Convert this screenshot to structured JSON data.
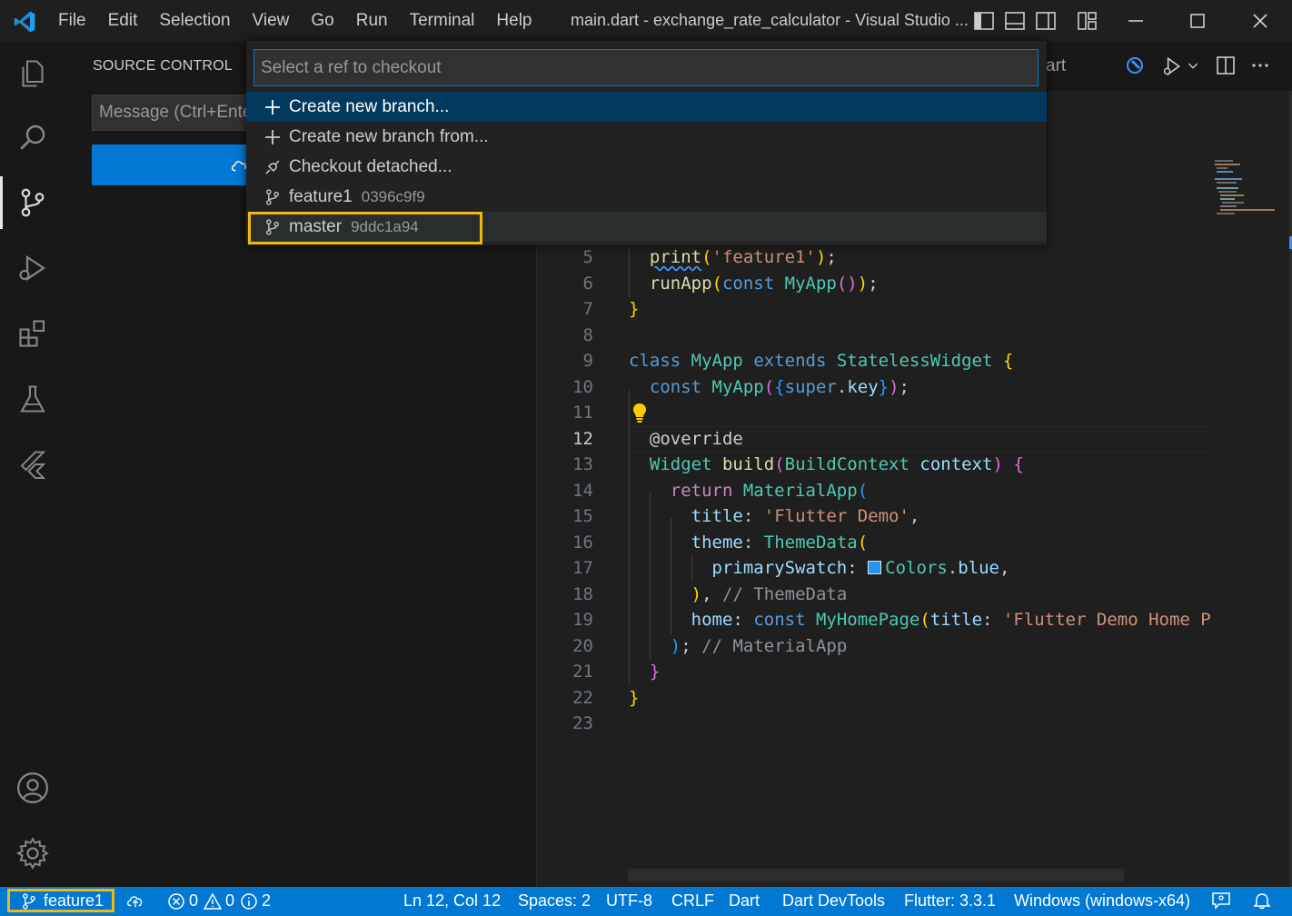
{
  "titlebar": {
    "menu": [
      "File",
      "Edit",
      "Selection",
      "View",
      "Go",
      "Run",
      "Terminal",
      "Help"
    ],
    "window_title": "main.dart - exchange_rate_calculator - Visual Studio ..."
  },
  "sidebar": {
    "title": "SOURCE CONTROL",
    "message_placeholder": "Message (Ctrl+Enter"
  },
  "editor": {
    "tab_partial": "art",
    "lines": [
      {
        "n": "5"
      },
      {
        "n": "6"
      },
      {
        "n": "7"
      },
      {
        "n": "8"
      },
      {
        "n": "9"
      },
      {
        "n": "10"
      },
      {
        "n": "11"
      },
      {
        "n": "12"
      },
      {
        "n": "13"
      },
      {
        "n": "14"
      },
      {
        "n": "15"
      },
      {
        "n": "16"
      },
      {
        "n": "17"
      },
      {
        "n": "18"
      },
      {
        "n": "19"
      },
      {
        "n": "20"
      },
      {
        "n": "21"
      },
      {
        "n": "22"
      },
      {
        "n": "23"
      }
    ],
    "code": {
      "print_fn": "print",
      "print_arg": "'feature1'",
      "runapp_fn": "runApp",
      "const_kw": "const",
      "myapp_cls": "MyApp",
      "class_kw": "class",
      "extends_kw": "extends",
      "stateless_cls": "StatelessWidget",
      "super_kw": "super",
      "key_prop": "key",
      "override_ann": "@override",
      "widget_cls": "Widget",
      "build_fn": "build",
      "buildcontext_cls": "BuildContext",
      "context_var": "context",
      "return_kw": "return",
      "materialapp_cls": "MaterialApp",
      "title_prop": "title",
      "title_val": "'Flutter Demo'",
      "theme_prop": "theme",
      "themedata_cls": "ThemeData",
      "primary_prop": "primarySwatch",
      "colors_cls": "Colors",
      "blue_prop": "blue",
      "themedata_comment": "// ThemeData",
      "home_prop": "home",
      "homepage_cls": "MyHomePage",
      "homepage_title_val": "'Flutter Demo Home P",
      "materialapp_comment": "// MaterialApp"
    }
  },
  "quickpick": {
    "placeholder": "Select a ref to checkout",
    "items": [
      {
        "label": "Create new branch...",
        "desc": "",
        "icon": "plus-icon"
      },
      {
        "label": "Create new branch from...",
        "desc": "",
        "icon": "plus-icon"
      },
      {
        "label": "Checkout detached...",
        "desc": "",
        "icon": "debug-disconnect-icon"
      },
      {
        "label": "feature1",
        "desc": "0396c9f9",
        "icon": "git-branch-icon"
      },
      {
        "label": "master",
        "desc": "9ddc1a94",
        "icon": "git-branch-icon"
      }
    ]
  },
  "statusbar": {
    "branch": "feature1",
    "errors": "0",
    "warnings": "0",
    "infos": "2",
    "position": "Ln 12, Col 12",
    "spaces": "Spaces: 2",
    "encoding": "UTF-8",
    "eol": "CRLF",
    "language": "Dart",
    "devtools": "Dart DevTools",
    "flutter": "Flutter: 3.3.1",
    "device": "Windows (windows-x64)"
  },
  "colors": {
    "accent": "#0078d4",
    "selection": "#04395e",
    "highlight_box": "#f2b80a"
  }
}
